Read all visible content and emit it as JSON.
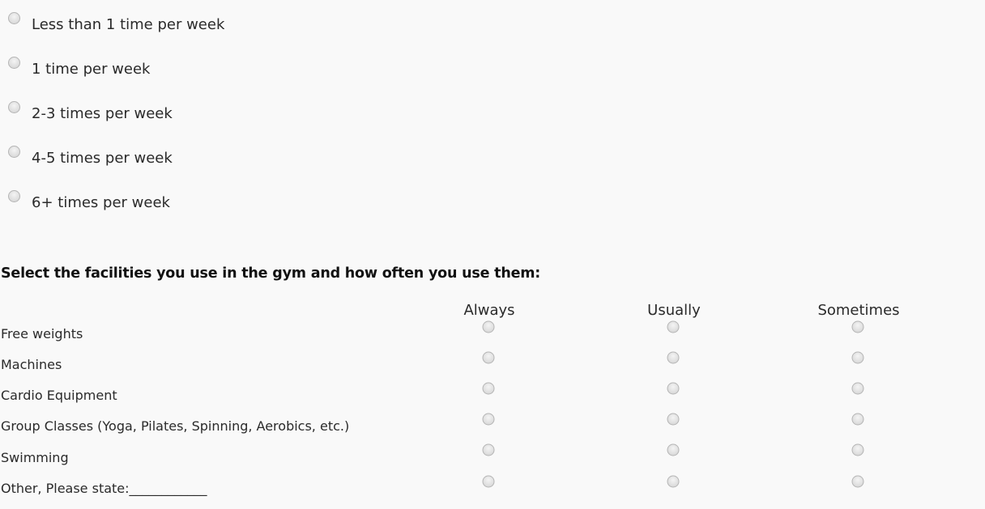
{
  "frequency_options": [
    {
      "label": "Less than 1 time per week"
    },
    {
      "label": "1 time per week"
    },
    {
      "label": "2-3 times per week"
    },
    {
      "label": "4-5 times per week"
    },
    {
      "label": "6+ times per week"
    }
  ],
  "facilities_question": {
    "title": "Select the facilities you use in the gym and how often you use them:",
    "columns": [
      "Always",
      "Usually",
      "Sometimes"
    ],
    "rows": [
      {
        "label": "Free weights"
      },
      {
        "label": "Machines"
      },
      {
        "label": "Cardio Equipment"
      },
      {
        "label": "Group Classes (Yoga, Pilates, Spinning, Aerobics, etc.)"
      },
      {
        "label": "Swimming"
      },
      {
        "label": "Other, Please state:____________"
      }
    ]
  }
}
